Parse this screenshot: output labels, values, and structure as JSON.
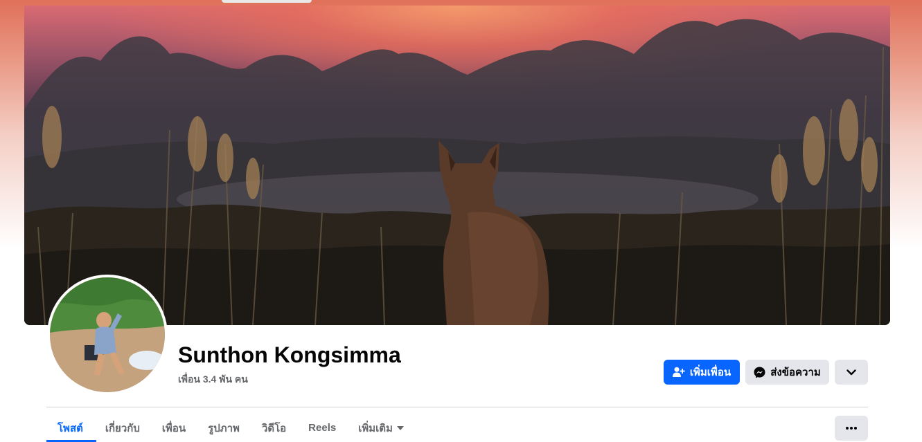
{
  "profile": {
    "name": "Sunthon Kongsimma",
    "friends_count": "เพื่อน 3.4 พัน คน"
  },
  "actions": {
    "add_friend_label": "เพิ่มเพื่อน",
    "message_label": "ส่งข้อความ",
    "add_friend_icon": "person-plus-icon",
    "message_icon": "messenger-icon",
    "more_icon": "chevron-down-icon"
  },
  "tabs": [
    {
      "label": "โพสต์",
      "active": true
    },
    {
      "label": "เกี่ยวกับ",
      "active": false
    },
    {
      "label": "เพื่อน",
      "active": false
    },
    {
      "label": "รูปภาพ",
      "active": false
    },
    {
      "label": "วิดีโอ",
      "active": false
    },
    {
      "label": "Reels",
      "active": false
    },
    {
      "label": "เพิ่มเติม",
      "active": false
    }
  ],
  "tab_more_icon": "caret-down-icon",
  "overflow_icon": "ellipsis-icon",
  "colors": {
    "accent": "#0866ff",
    "button_gray": "#e4e6eb",
    "text_primary": "#050505",
    "text_secondary": "#65676b"
  }
}
